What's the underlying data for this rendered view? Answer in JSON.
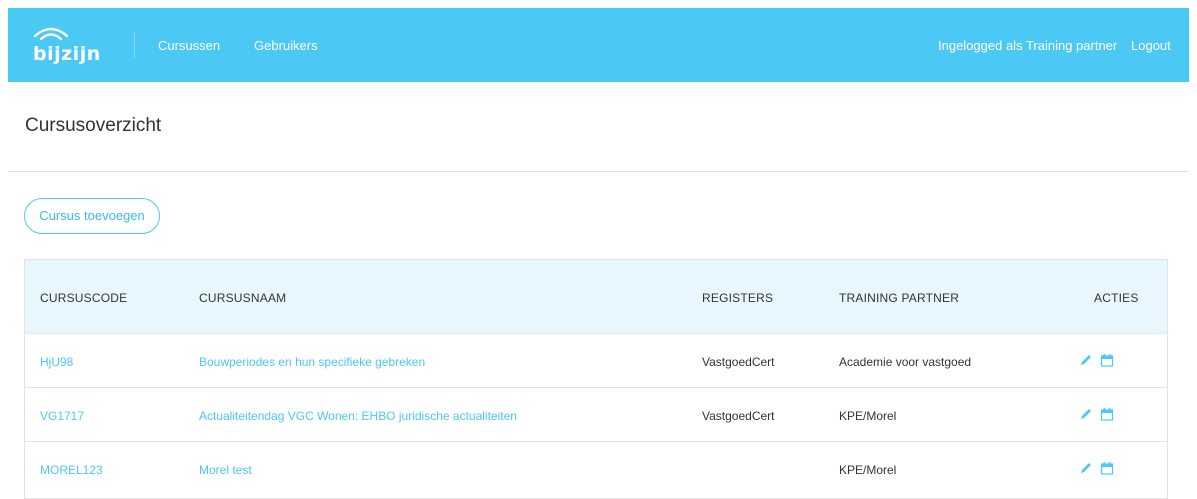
{
  "brand": {
    "logo_text": "bijzijn",
    "color": "#4cc8f4"
  },
  "nav": {
    "links": [
      {
        "label": "Cursussen"
      },
      {
        "label": "Gebruikers"
      }
    ],
    "logged_in_text": "Ingelogged als Training partner",
    "logout_label": "Logout"
  },
  "page": {
    "title": "Cursusoverzicht",
    "add_button_label": "Cursus toevoegen"
  },
  "table": {
    "columns": [
      "CURSUSCODE",
      "CURSUSNAAM",
      "REGISTERS",
      "TRAINING PARTNER",
      "ACTIES"
    ],
    "rows": [
      {
        "code": "HjU98",
        "name": "Bouwperiodes en hun specifieke gebreken",
        "registers": "VastgoedCert",
        "partner": "Academie voor vastgoed",
        "actions": [
          "pencil-icon",
          "calendar-icon"
        ]
      },
      {
        "code": "VG1717",
        "name": "Actualiteitendag VGC Wonen: EHBO juridische actualiteiten",
        "registers": "VastgoedCert",
        "partner": "KPE/Morel",
        "actions": [
          "pencil-icon",
          "calendar-icon"
        ]
      },
      {
        "code": "MOREL123",
        "name": "Morel test",
        "registers": "",
        "partner": "KPE/Morel",
        "actions": [
          "pencil-icon",
          "calendar-icon"
        ]
      }
    ]
  },
  "colors": {
    "accent": "#4cc8f4",
    "header_row": "#e8f7fd",
    "border": "#e2e2e2"
  }
}
